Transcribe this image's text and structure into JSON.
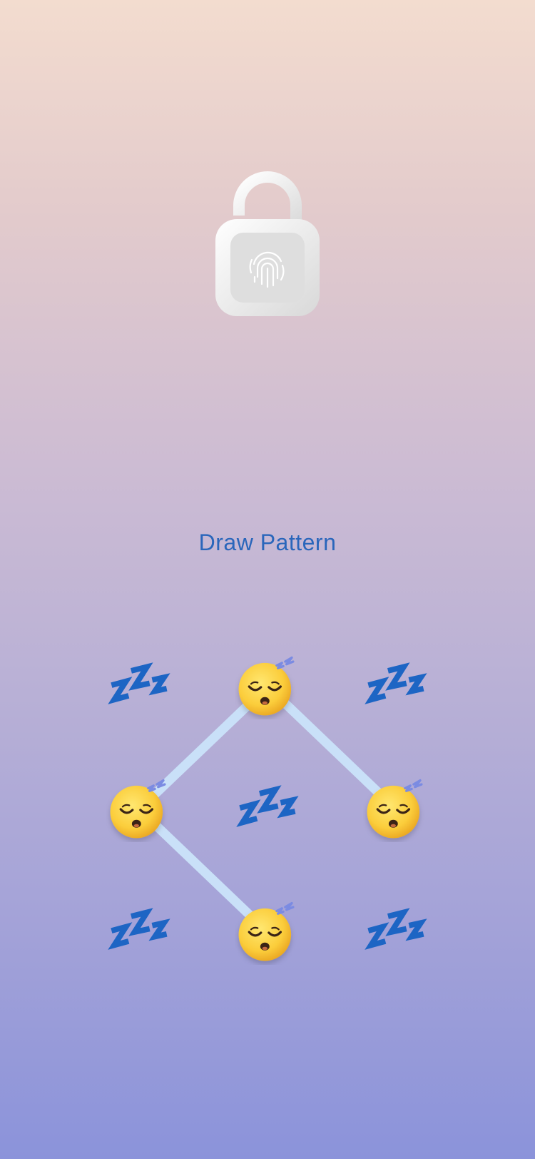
{
  "lock_screen": {
    "prompt": "Draw Pattern",
    "lock_icon": "unlocked-padlock-fingerprint-icon",
    "colors": {
      "prompt_text": "#2a66bb",
      "pattern_line": "#c9e0f8",
      "zzz_symbol": "#1d65c4"
    }
  },
  "pattern_grid": {
    "rows": 3,
    "columns": 3,
    "nodes": [
      {
        "row": 1,
        "col": 1,
        "state": "inactive",
        "icon": "zzz-icon"
      },
      {
        "row": 1,
        "col": 2,
        "state": "selected",
        "icon": "sleeping-face-icon"
      },
      {
        "row": 1,
        "col": 3,
        "state": "inactive",
        "icon": "zzz-icon"
      },
      {
        "row": 2,
        "col": 1,
        "state": "selected",
        "icon": "sleeping-face-icon"
      },
      {
        "row": 2,
        "col": 2,
        "state": "inactive",
        "icon": "zzz-icon"
      },
      {
        "row": 2,
        "col": 3,
        "state": "selected",
        "icon": "sleeping-face-icon"
      },
      {
        "row": 3,
        "col": 1,
        "state": "inactive",
        "icon": "zzz-icon"
      },
      {
        "row": 3,
        "col": 2,
        "state": "selected",
        "icon": "sleeping-face-icon"
      },
      {
        "row": 3,
        "col": 3,
        "state": "inactive",
        "icon": "zzz-icon"
      }
    ],
    "connections": [
      {
        "from": {
          "row": 1,
          "col": 2
        },
        "to": {
          "row": 2,
          "col": 1
        }
      },
      {
        "from": {
          "row": 1,
          "col": 2
        },
        "to": {
          "row": 2,
          "col": 3
        }
      },
      {
        "from": {
          "row": 2,
          "col": 1
        },
        "to": {
          "row": 3,
          "col": 2
        }
      }
    ]
  }
}
